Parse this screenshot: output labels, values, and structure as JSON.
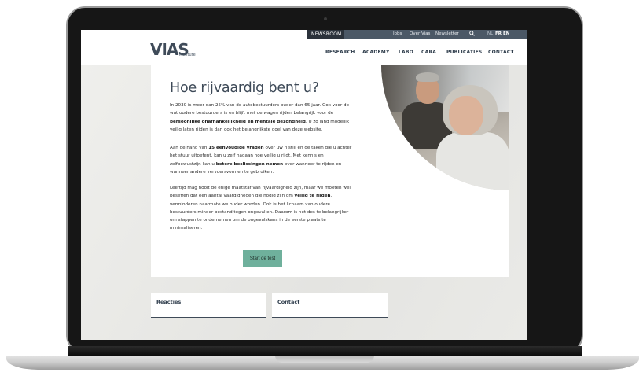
{
  "utility_bar": {
    "newsroom": "NEWSROOM",
    "links": [
      "Jobs",
      "Over Vias",
      "Newsletter"
    ],
    "languages": [
      "NL",
      "FR",
      "EN"
    ]
  },
  "brand": {
    "logo_text": "VIAS",
    "subtitle": "institute"
  },
  "nav": {
    "items": [
      "RESEARCH",
      "ACADEMY",
      "LABO",
      "CARA",
      "PUBLICATIES",
      "CONTACT"
    ]
  },
  "main": {
    "title": "Hoe rijvaardig bent u?",
    "p1": {
      "before": "In 2030 is meer dan 25% van de autobestuurders ouder dan 65 jaar. Ook voor de wat oudere bestuurders is en blijft met de wagen rijden belangrijk voor de ",
      "bold": "persoonlijke onafhankelijkheid en mentale gezondheid",
      "after": ". U zo lang mogelijk veilig laten rijden is dan ook het belangrijkste doel van deze website."
    },
    "p2": {
      "a": "Aan de hand van ",
      "b1": "15 eenvoudige vragen",
      "c": " over uw rijstijl en de taken die u achter het stuur uitoefent, kan u zelf nagaan hoe veilig u rijdt. Met kennis en zelfbewustzijn kan u ",
      "b2": "betere beslissingen nemen",
      "d": " over wanneer te rijden en wanneer andere vervoersvormen te gebruiken."
    },
    "p3": {
      "a": "Leeftijd mag nooit de enige maatstaf van rijvaardigheid zijn, maar we moeten wel beseffen dat een aantal vaardigheden die nodig zijn om ",
      "b": "veilig te rijden",
      "c": ", verminderen naarmate we ouder worden. Ook is het lichaam van oudere bestuurders minder bestand tegen ongevallen. Daarom is het des te belangrijker om stappen te ondernemen om de ongevalskans in de eerste plaats te minimaliseren."
    },
    "start_button": "Start de test"
  },
  "bottom_cards": [
    "Reacties",
    "Contact"
  ],
  "colors": {
    "accent_green": "#6fb09c",
    "nav_dark": "#4b5866",
    "text_dark": "#3e4a58"
  },
  "icons": {
    "search": "search-icon"
  }
}
